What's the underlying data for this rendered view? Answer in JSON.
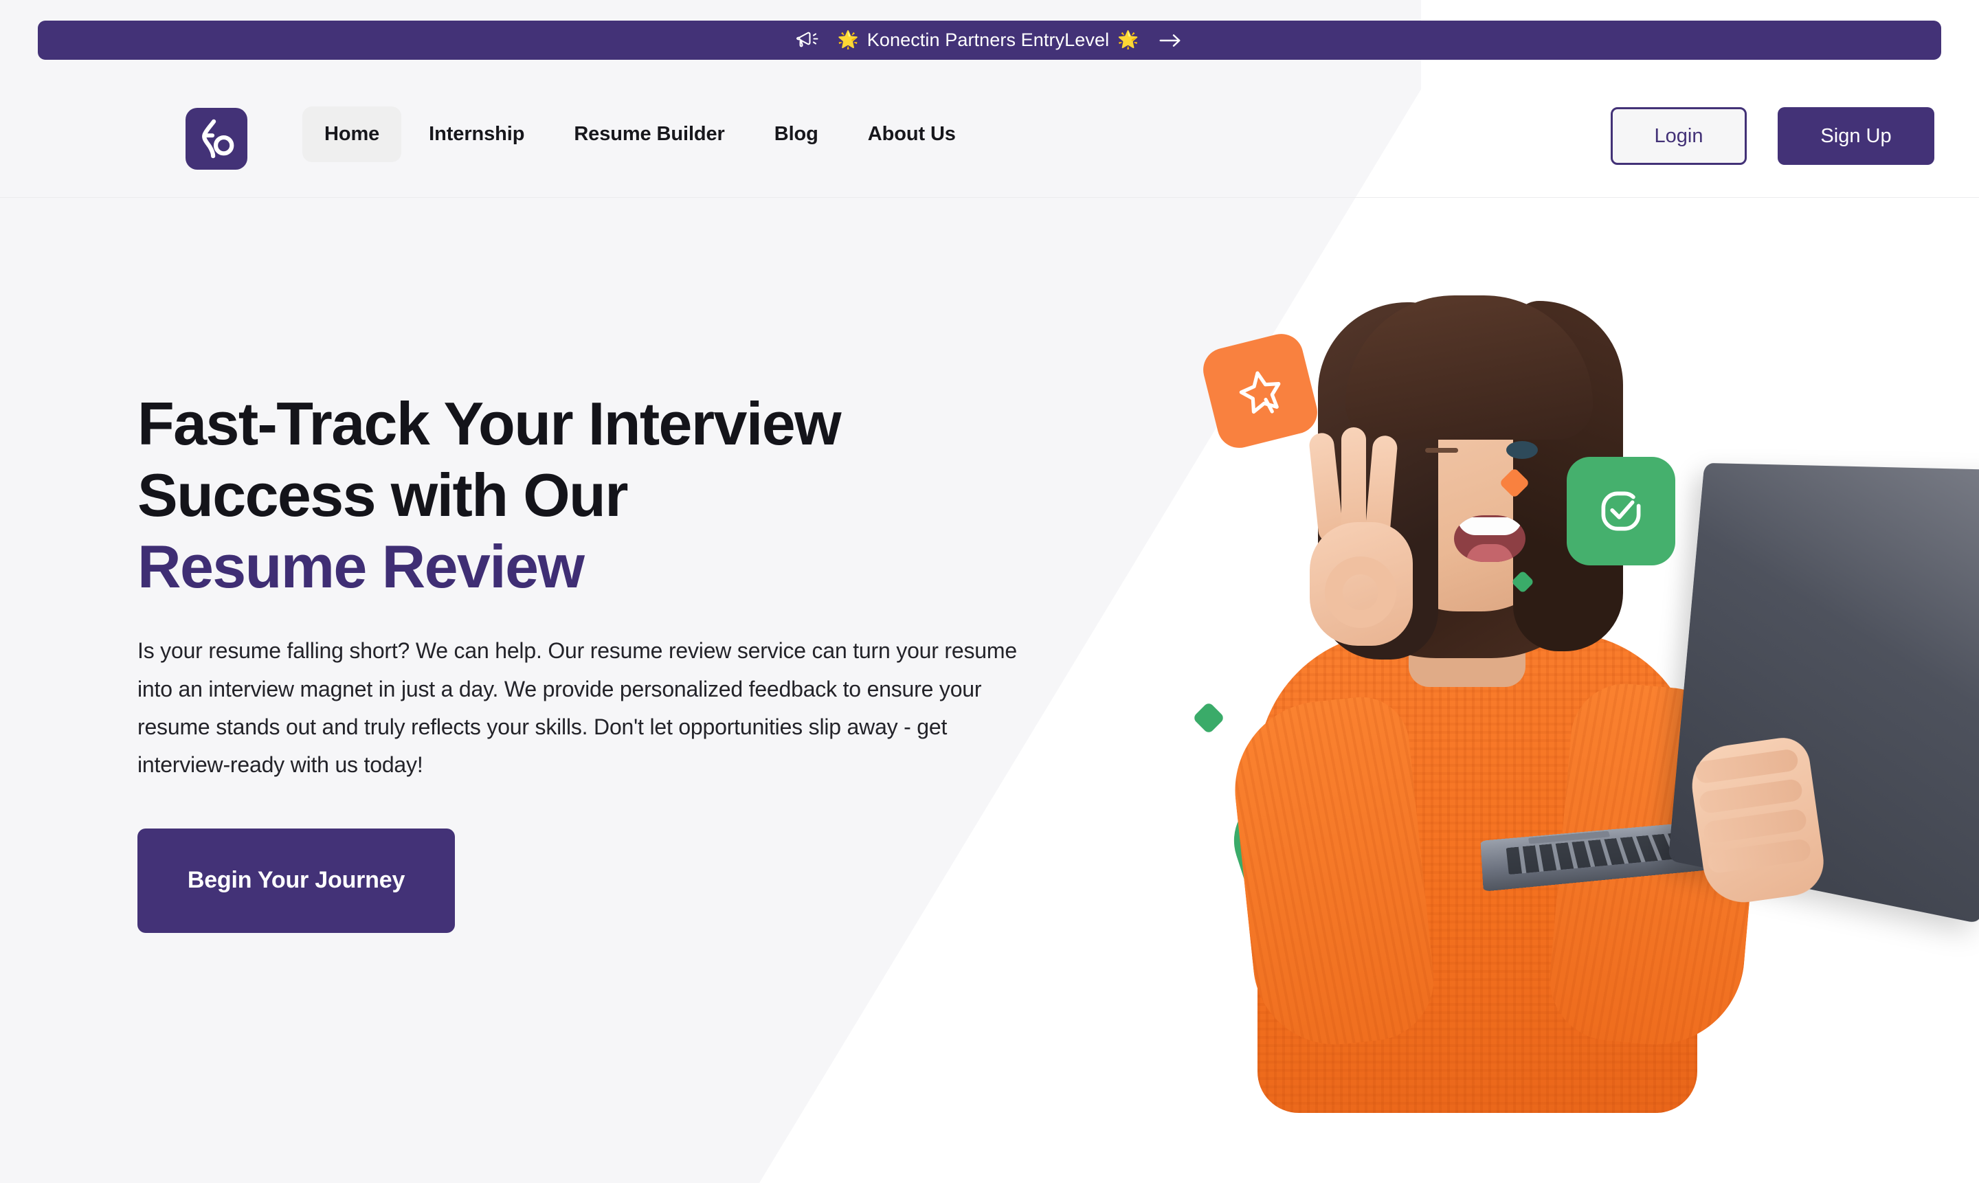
{
  "banner": {
    "megaphone_icon": "megaphone-icon",
    "star_left": "🌟",
    "text": "Konectin Partners EntryLevel",
    "star_right": "🌟",
    "arrow_icon": "arrow-right-icon",
    "bg_color": "#433277"
  },
  "header": {
    "logo_alt": "Konectin logo",
    "nav": [
      {
        "label": "Home",
        "active": true
      },
      {
        "label": "Internship",
        "active": false
      },
      {
        "label": "Resume Builder",
        "active": false
      },
      {
        "label": "Blog",
        "active": false
      },
      {
        "label": "About Us",
        "active": false
      }
    ],
    "login_label": "Login",
    "signup_label": "Sign Up"
  },
  "hero": {
    "headline_line1": "Fast-Track Your Interview",
    "headline_line2": "Success with Our",
    "headline_accent": "Resume Review",
    "paragraph": "Is your resume falling short? We can help. Our resume review service can turn your resume into an interview magnet in just a day. We provide personalized feedback to ensure your resume stands out and truly reflects your skills. Don't let opportunities slip away - get interview-ready with us today!",
    "cta_label": "Begin Your Journey",
    "art": {
      "star_badge_icon": "star-badge-icon",
      "check_badge_icon": "check-badge-icon",
      "orange_diamond_icon": "orange-diamond-accent",
      "green_diamond_icon": "green-diamond-accent",
      "person_alt": "smiling woman in orange sweater holding a laptop and making an OK hand gesture"
    }
  },
  "colors": {
    "brand_purple": "#433277",
    "accent_orange": "#f9813f",
    "accent_green": "#45b06d",
    "page_bg_left": "#f6f6f8",
    "page_bg_right": "#ffffff",
    "text_dark": "#14141a"
  }
}
